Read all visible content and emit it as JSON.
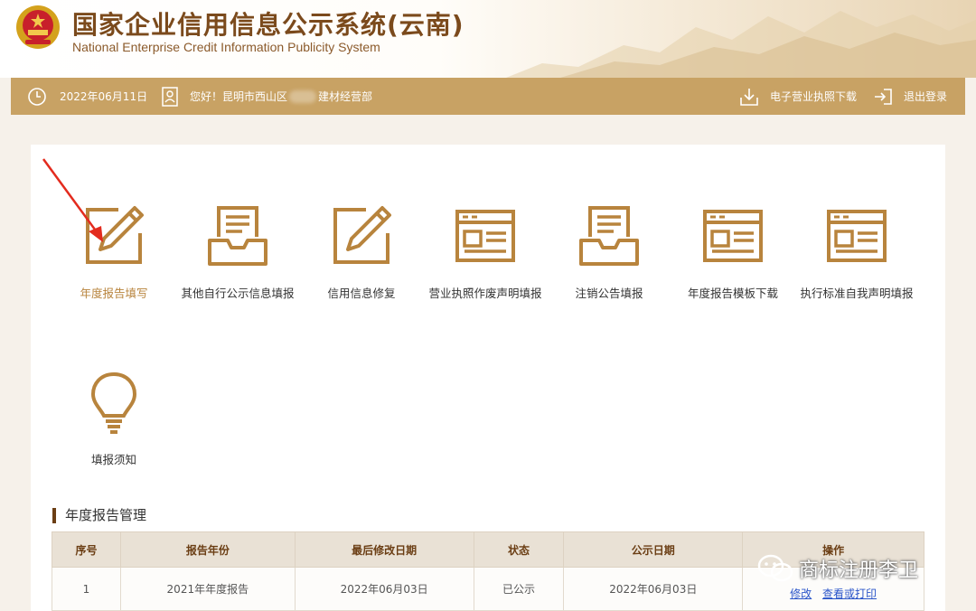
{
  "header": {
    "title_cn": "国家企业信用信息公示系统(云南)",
    "title_en": "National Enterprise Credit Information Publicity System",
    "emblem_icon": "national-emblem"
  },
  "topbar": {
    "date": "2022年06月11日",
    "greeting_prefix": "您好！昆明市西山区",
    "greeting_suffix": "建材经营部",
    "download_license": "电子营业执照下载",
    "logout": "退出登录"
  },
  "functions": [
    {
      "label": "年度报告填写",
      "icon": "edit-icon",
      "active": true
    },
    {
      "label": "其他自行公示信息填报",
      "icon": "inbox-icon"
    },
    {
      "label": "信用信息修复",
      "icon": "edit-icon"
    },
    {
      "label": "营业执照作废声明填报",
      "icon": "document-window-icon"
    },
    {
      "label": "注销公告填报",
      "icon": "inbox-icon"
    },
    {
      "label": "年度报告模板下载",
      "icon": "document-window-icon"
    },
    {
      "label": "执行标准自我声明填报",
      "icon": "document-window-icon"
    },
    {
      "label": "填报须知",
      "icon": "lightbulb-icon"
    }
  ],
  "section": {
    "title": "年度报告管理"
  },
  "table": {
    "headers": [
      "序号",
      "报告年份",
      "最后修改日期",
      "状态",
      "公示日期",
      "操作"
    ],
    "rows": [
      {
        "no": "1",
        "year": "2021年年度报告",
        "modified": "2022年06月03日",
        "status": "已公示",
        "published": "2022年06月03日",
        "action_edit": "修改",
        "action_view": "查看或打印"
      }
    ]
  },
  "watermark": "商标注册李卫",
  "colors": {
    "gold": "#c8a264",
    "brown": "#6b3e14",
    "active_text": "#b8843d",
    "icon": "#b8843d"
  }
}
